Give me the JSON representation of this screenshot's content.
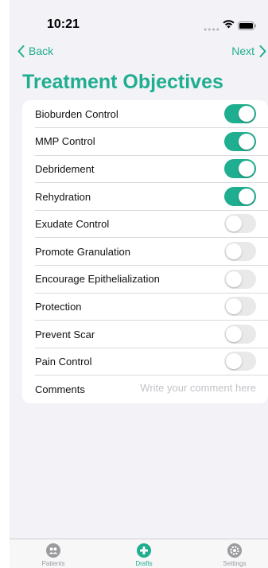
{
  "status": {
    "time": "10:21"
  },
  "nav": {
    "back_label": "Back",
    "next_label": "Next"
  },
  "page": {
    "title": "Treatment Objectives"
  },
  "objectives": [
    {
      "label": "Bioburden Control",
      "enabled": true
    },
    {
      "label": "MMP Control",
      "enabled": true
    },
    {
      "label": "Debridement",
      "enabled": true
    },
    {
      "label": "Rehydration",
      "enabled": true
    },
    {
      "label": "Exudate Control",
      "enabled": false
    },
    {
      "label": "Promote Granulation",
      "enabled": false
    },
    {
      "label": "Encourage Epithelialization",
      "enabled": false
    },
    {
      "label": "Protection",
      "enabled": false
    },
    {
      "label": "Prevent Scar",
      "enabled": false
    },
    {
      "label": "Pain Control",
      "enabled": false
    }
  ],
  "comments": {
    "label": "Comments",
    "value": "",
    "placeholder": "Write your comment here"
  },
  "tabbar": {
    "tabs": [
      {
        "label": "Patients",
        "icon": "patients-icon",
        "active": false
      },
      {
        "label": "Drafts",
        "icon": "plus-circle-icon",
        "active": true
      },
      {
        "label": "Settings",
        "icon": "gear-icon",
        "active": false
      }
    ]
  },
  "colors": {
    "accent": "#1fae8f",
    "toggle_off": "#e9e9ea",
    "background": "#f2f2f7"
  }
}
